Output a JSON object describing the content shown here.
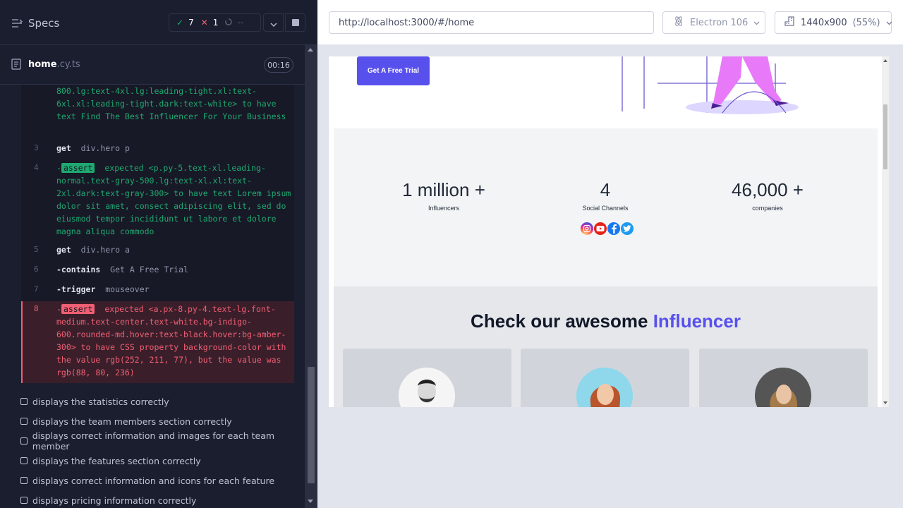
{
  "reporter": {
    "specs_label": "Specs",
    "passed_count": "7",
    "failed_count": "1",
    "pending_count": "--",
    "spec_file": {
      "name": "home",
      "ext": ".cy.ts",
      "duration": "00:16"
    },
    "commands": [
      {
        "num": "",
        "parts": [
          {
            "t": "800.lg:text-4xl.lg:leading-tight.xl:text-6xl.xl:leading-tight.dark:text-white> ",
            "c": "green"
          },
          {
            "t": "to have text ",
            "c": "green"
          },
          {
            "t": "Find The Best Influencer For Your Business",
            "c": "green"
          }
        ]
      },
      {
        "num": "3",
        "name": "get",
        "arg": "div.hero p"
      },
      {
        "num": "4",
        "assert": true,
        "parts": [
          {
            "t": "expected ",
            "c": "green"
          },
          {
            "t": "<p.py-5.text-xl.leading-normal.text-gray-500.lg:text-xl.xl:text-2xl.dark:text-gray-300>",
            "c": "green"
          },
          {
            "t": " to have text ",
            "c": "green"
          },
          {
            "t": "Lorem ipsum dolor sit amet, consect adipiscing elit, sed do eiusmod tempor incididunt ut labore et dolore magna aliqua commodo",
            "c": "green"
          }
        ]
      },
      {
        "num": "5",
        "name": "get",
        "arg": "div.hero a"
      },
      {
        "num": "6",
        "name": "-contains",
        "arg": "Get A Free Trial"
      },
      {
        "num": "7",
        "name": "-trigger",
        "arg": "mouseover"
      },
      {
        "num": "8",
        "assert": true,
        "failed": true,
        "parts": [
          {
            "t": "expected ",
            "c": "red"
          },
          {
            "t": "<a.px-8.py-4.text-lg.font-medium.text-center.text-white.bg-indigo-600.rounded-md.hover:text-black.hover:bg-amber-300>",
            "c": "red"
          },
          {
            "t": " to have CSS property ",
            "c": "red"
          },
          {
            "t": "background-color",
            "c": "red"
          },
          {
            "t": " with the value ",
            "c": "red"
          },
          {
            "t": "rgb(252, 211, 77)",
            "c": "red"
          },
          {
            "t": ", but the value was ",
            "c": "red"
          },
          {
            "t": "rgb(88, 80, 236)",
            "c": "red"
          }
        ]
      }
    ],
    "assert_label": "assert",
    "tests": [
      "displays the statistics correctly",
      "displays the team members section correctly",
      "displays correct information and images for each team member",
      "displays the features section correctly",
      "displays correct information and icons for each feature",
      "displays pricing information correctly"
    ]
  },
  "aut": {
    "url": "http://localhost:3000/#/home",
    "browser": "Electron 106",
    "viewport": "1440x900",
    "scale": "(55%)",
    "hero_button": "Get A Free Trial",
    "stats": [
      {
        "value": "1 million +",
        "label": "Influencers"
      },
      {
        "value": "4",
        "label": "Social Channels"
      },
      {
        "value": "46,000 +",
        "label": "companies"
      }
    ],
    "team_title_prefix": "Check our awesome ",
    "team_title_accent": "Influencer",
    "colors": {
      "accent": "#5850ec",
      "pass": "#1fa971",
      "fail": "#f05f73"
    }
  }
}
